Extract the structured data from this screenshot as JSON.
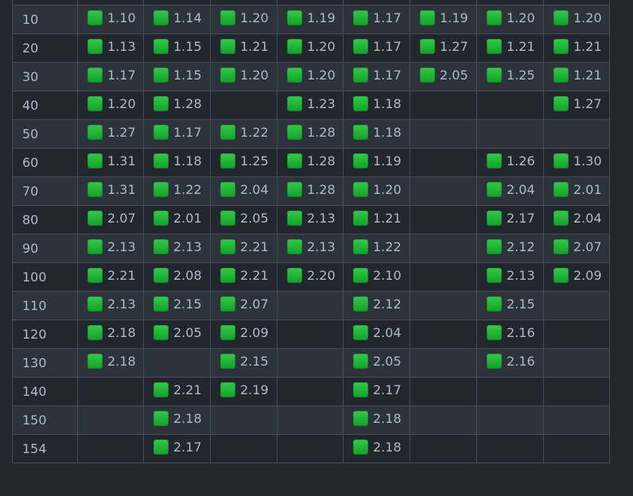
{
  "colors": {
    "background": "#22272e",
    "row_alt": "#2d333b",
    "border": "#444c56",
    "text": "#adbac7",
    "status_green": "#22b33a"
  },
  "status_icon": "green-square-icon",
  "rows": [
    {
      "key": "",
      "vals": [
        "",
        "",
        "",
        "",
        "",
        "",
        "",
        ""
      ]
    },
    {
      "key": "10",
      "vals": [
        "1.10",
        "1.14",
        "1.20",
        "1.19",
        "1.17",
        "1.19",
        "1.20",
        "1.20"
      ]
    },
    {
      "key": "20",
      "vals": [
        "1.13",
        "1.15",
        "1.21",
        "1.20",
        "1.17",
        "1.27",
        "1.21",
        "1.21"
      ]
    },
    {
      "key": "30",
      "vals": [
        "1.17",
        "1.15",
        "1.20",
        "1.20",
        "1.17",
        "2.05",
        "1.25",
        "1.21"
      ]
    },
    {
      "key": "40",
      "vals": [
        "1.20",
        "1.28",
        "",
        "1.23",
        "1.18",
        "",
        "",
        "1.27"
      ]
    },
    {
      "key": "50",
      "vals": [
        "1.27",
        "1.17",
        "1.22",
        "1.28",
        "1.18",
        "",
        "",
        ""
      ]
    },
    {
      "key": "60",
      "vals": [
        "1.31",
        "1.18",
        "1.25",
        "1.28",
        "1.19",
        "",
        "1.26",
        "1.30"
      ]
    },
    {
      "key": "70",
      "vals": [
        "1.31",
        "1.22",
        "2.04",
        "1.28",
        "1.20",
        "",
        "2.04",
        "2.01"
      ]
    },
    {
      "key": "80",
      "vals": [
        "2.07",
        "2.01",
        "2.05",
        "2.13",
        "1.21",
        "",
        "2.17",
        "2.04"
      ]
    },
    {
      "key": "90",
      "vals": [
        "2.13",
        "2.13",
        "2.21",
        "2.13",
        "1.22",
        "",
        "2.12",
        "2.07"
      ]
    },
    {
      "key": "100",
      "vals": [
        "2.21",
        "2.08",
        "2.21",
        "2.20",
        "2.10",
        "",
        "2.13",
        "2.09"
      ]
    },
    {
      "key": "110",
      "vals": [
        "2.13",
        "2.15",
        "2.07",
        "",
        "2.12",
        "",
        "2.15",
        ""
      ]
    },
    {
      "key": "120",
      "vals": [
        "2.18",
        "2.05",
        "2.09",
        "",
        "2.04",
        "",
        "2.16",
        ""
      ]
    },
    {
      "key": "130",
      "vals": [
        "2.18",
        "",
        "2.15",
        "",
        "2.05",
        "",
        "2.16",
        ""
      ]
    },
    {
      "key": "140",
      "vals": [
        "",
        "2.21",
        "2.19",
        "",
        "2.17",
        "",
        "",
        ""
      ]
    },
    {
      "key": "150",
      "vals": [
        "",
        "2.18",
        "",
        "",
        "2.18",
        "",
        "",
        ""
      ]
    },
    {
      "key": "154",
      "vals": [
        "",
        "2.17",
        "",
        "",
        "2.18",
        "",
        "",
        ""
      ]
    }
  ]
}
